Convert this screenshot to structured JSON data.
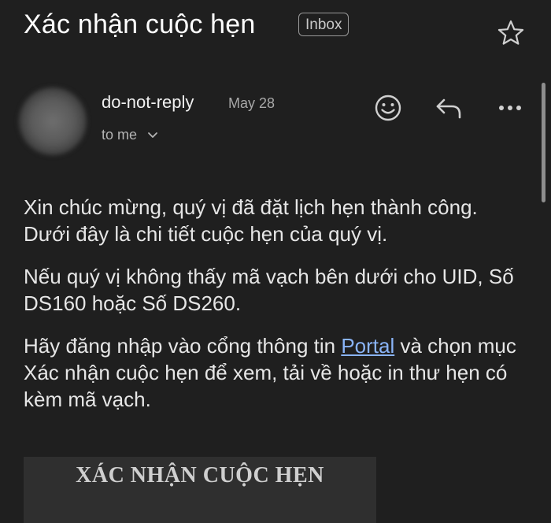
{
  "email": {
    "subject": "Xác nhận cuộc hẹn",
    "label": "Inbox",
    "sender": "do-not-reply",
    "date": "May 28",
    "recipient_line": "to me"
  },
  "icons": {
    "star": "star-icon",
    "emoji": "emoji-reaction-icon",
    "reply": "reply-icon",
    "more": "more-horizontal-icon",
    "chevron": "chevron-down-icon"
  },
  "body": {
    "paragraph1": "Xin chúc mừng, quý vị đã đặt lịch hẹn thành công. Dưới đây là chi tiết cuộc hẹn của quý vị.",
    "paragraph2": "Nếu quý vị không thấy mã vạch bên dưới cho UID, Số DS160 hoặc Số DS260.",
    "paragraph3_before_link": "Hãy đăng nhập vào cổng thông tin ",
    "paragraph3_link": "Portal",
    "paragraph3_after_link": " và chọn mục Xác nhận cuộc hẹn để xem, tải về hoặc in thư hẹn có kèm mã vạch."
  },
  "attachment": {
    "title": "XÁC NHẬN CUỘC HẸN"
  },
  "colors": {
    "background": "#1f1f1f",
    "link": "#8ab4f8",
    "text": "#e6e6e6"
  }
}
